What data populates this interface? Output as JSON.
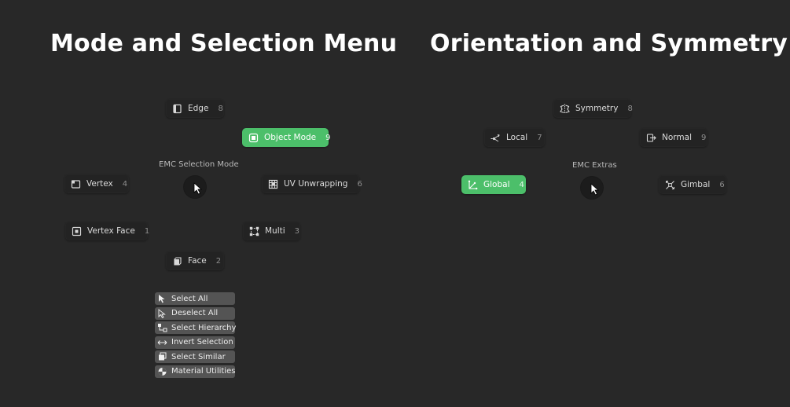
{
  "headings": {
    "left": "Mode and Selection Menu",
    "right": "Orientation and Symmetry"
  },
  "left_pie": {
    "title": "EMC Selection Mode",
    "items": {
      "edge": {
        "label": "Edge",
        "key": "8",
        "icon": "edge-icon"
      },
      "object_mode": {
        "label": "Object Mode",
        "key": "9",
        "icon": "object-mode-icon",
        "active": true
      },
      "vertex": {
        "label": "Vertex",
        "key": "4",
        "icon": "vertex-icon"
      },
      "uv_unwrapping": {
        "label": "UV Unwrapping",
        "key": "6",
        "icon": "uv-unwrapping-icon"
      },
      "vertex_face": {
        "label": "Vertex Face",
        "key": "1",
        "icon": "vertex-face-icon"
      },
      "multi": {
        "label": "Multi",
        "key": "3",
        "icon": "multi-icon"
      },
      "face": {
        "label": "Face",
        "key": "2",
        "icon": "face-icon"
      }
    }
  },
  "right_pie": {
    "title": "EMC Extras",
    "items": {
      "symmetry": {
        "label": "Symmetry",
        "key": "8",
        "icon": "symmetry-icon"
      },
      "local": {
        "label": "Local",
        "key": "7",
        "icon": "local-icon"
      },
      "normal": {
        "label": "Normal",
        "key": "9",
        "icon": "normal-icon"
      },
      "global": {
        "label": "Global",
        "key": "4",
        "icon": "global-icon",
        "active": true
      },
      "gimbal": {
        "label": "Gimbal",
        "key": "6",
        "icon": "gimbal-icon"
      }
    }
  },
  "select_menu": [
    {
      "label": "Select All",
      "icon": "select-all-icon"
    },
    {
      "label": "Deselect All",
      "icon": "deselect-all-icon"
    },
    {
      "label": "Select Hierarchy",
      "icon": "select-hierarchy-icon"
    },
    {
      "label": "Invert Selection",
      "icon": "invert-selection-icon"
    },
    {
      "label": "Select Similar",
      "icon": "select-similar-icon"
    },
    {
      "label": "Material Utilities",
      "icon": "material-utilities-icon"
    }
  ],
  "colors": {
    "background": "#282828",
    "active": "#4cbf6a",
    "item_bg": "#232323",
    "menu_item_bg": "#545454"
  }
}
